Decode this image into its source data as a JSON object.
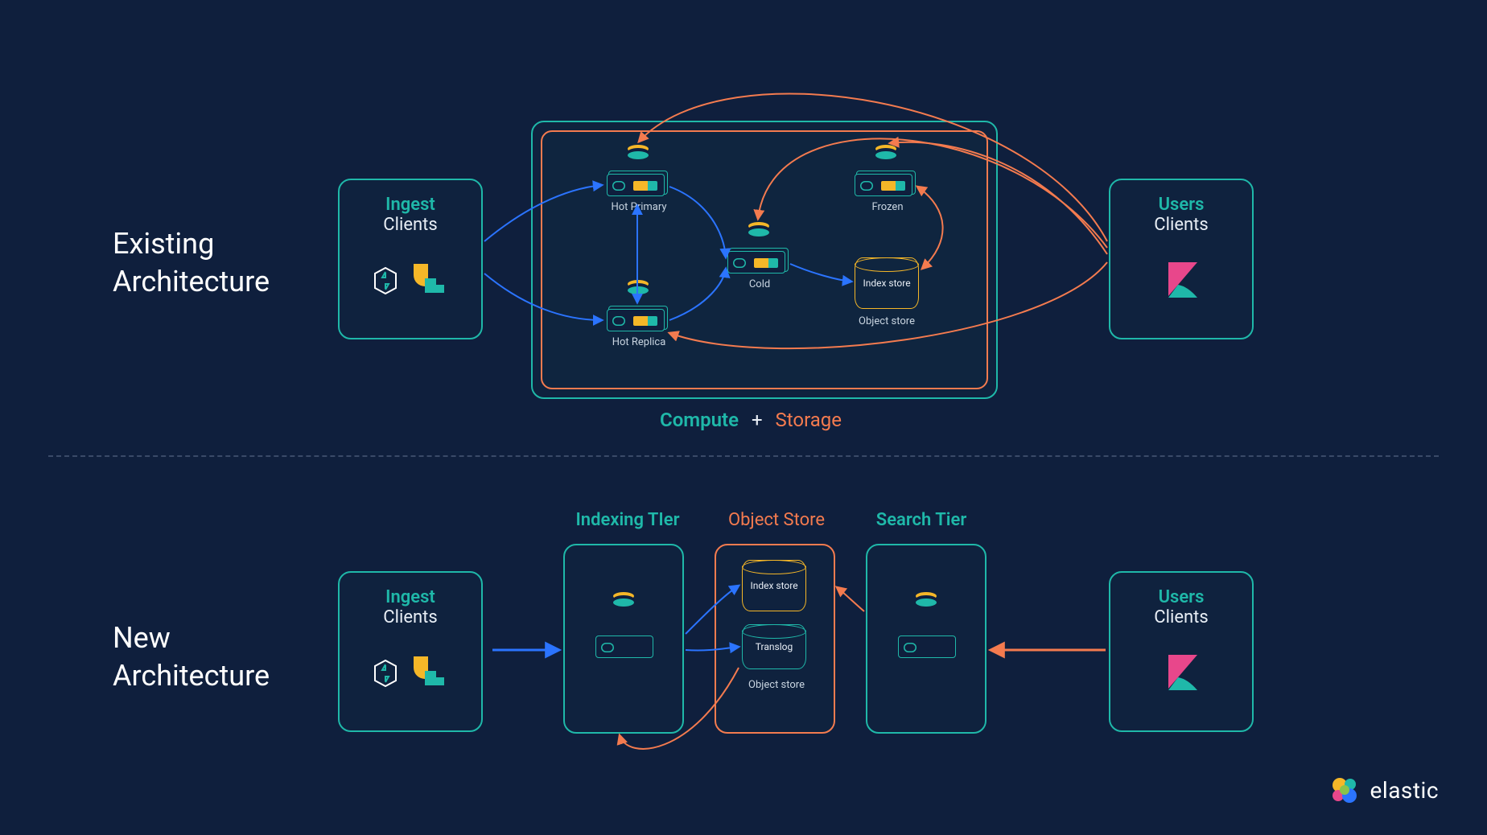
{
  "brand": {
    "name": "elastic"
  },
  "sections": {
    "existing": {
      "title_line1": "Existing",
      "title_line2": "Architecture"
    },
    "new": {
      "title_line1": "New",
      "title_line2": "Architecture"
    }
  },
  "existing": {
    "ingest": {
      "title": "Ingest",
      "subtitle": "Clients"
    },
    "users": {
      "title": "Users",
      "subtitle": "Clients"
    },
    "nodes": {
      "hot_primary": "Hot Primary",
      "hot_replica": "Hot Replica",
      "cold": "Cold",
      "frozen": "Frozen",
      "index_store": "Index store",
      "object_store_caption": "Object store"
    },
    "caption": {
      "compute": "Compute",
      "plus": "+",
      "storage": "Storage"
    }
  },
  "new": {
    "ingest": {
      "title": "Ingest",
      "subtitle": "Clients"
    },
    "users": {
      "title": "Users",
      "subtitle": "Clients"
    },
    "tiers": {
      "indexing": "Indexing TIer",
      "object_store": "Object Store",
      "search": "Search Tier"
    },
    "object": {
      "index_store": "Index store",
      "translog": "Translog",
      "caption": "Object store"
    }
  },
  "colors": {
    "teal": "#1fb8a9",
    "orange": "#f47b4f",
    "yellow": "#f5b728",
    "blue": "#2b74ff",
    "bg": "#0f1f3d"
  }
}
